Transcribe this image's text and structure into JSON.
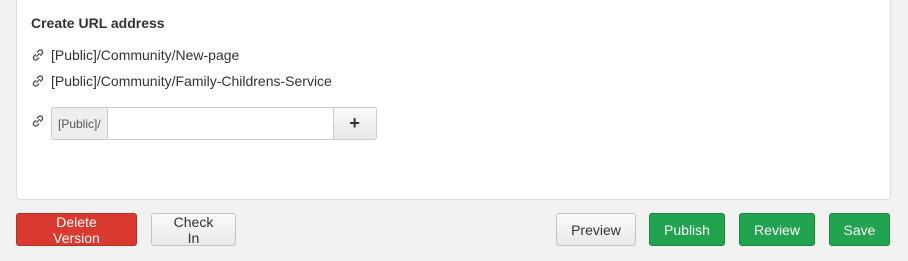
{
  "section": {
    "title": "Create URL address"
  },
  "urls": [
    {
      "text": "[Public]/Community/New-page",
      "icon": "link-icon"
    },
    {
      "text": "[Public]/Community/Family-Childrens-Service",
      "icon": "link-icon"
    }
  ],
  "create": {
    "prefix": "[Public]/",
    "input_value": "",
    "input_placeholder": "",
    "add_label": "+"
  },
  "actions": {
    "delete_version": "Delete Version",
    "check_in": "Check In",
    "preview": "Preview",
    "publish": "Publish",
    "review": "Review",
    "save": "Save"
  },
  "colors": {
    "danger": "#d9392f",
    "success": "#21a34f",
    "default_bg": "#f2f2f2"
  }
}
